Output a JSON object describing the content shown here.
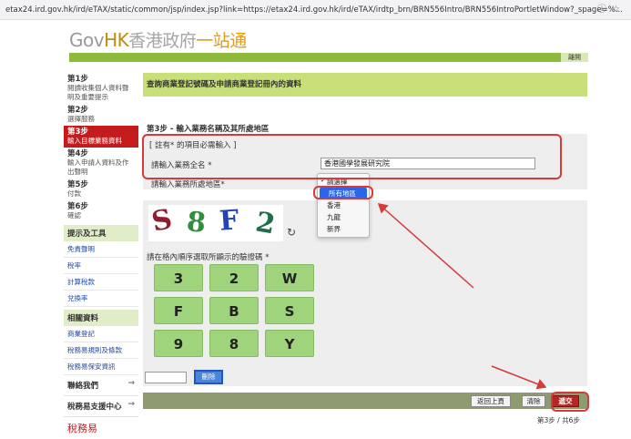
{
  "browser": {
    "url": "etax24.ird.gov.hk/ird/eTAX/static/common/jsp/index.jsp?link=https://etax24.ird.gov.hk/ird/eTAX/irdtp_brn/BRN556Intro/BRN556IntroPortletWindow?_spage=%..."
  },
  "header": {
    "logo_gov": "Gov",
    "logo_hk": "HK",
    "logo_zh": "香港政府",
    "logo_zh2": "一站通",
    "logout_label": "離開"
  },
  "sidebar": {
    "steps": [
      {
        "step": "第1步",
        "label": "閱讀收集個人資料聲明及重要提示"
      },
      {
        "step": "第2步",
        "label": "選擇服務"
      },
      {
        "step": "第3步",
        "label": "輸入目標業務資料",
        "active": true
      },
      {
        "step": "第4步",
        "label": "輸入申請人資料及作出聲明"
      },
      {
        "step": "第5步",
        "label": "付款"
      },
      {
        "step": "第6步",
        "label": "確認"
      }
    ],
    "tools_heading": "提示及工具",
    "tools": [
      "免責聲明",
      "稅率",
      "計算稅款",
      "兌換率"
    ],
    "related_heading": "相關資料",
    "related": [
      "商業登記",
      "稅務易規則及條款",
      "稅務易保安資訊"
    ],
    "contact_label": "聯絡我們",
    "support_label": "稅務易支援中心",
    "bottom_logo_text": "稅務易"
  },
  "main": {
    "title": "查詢商業登記號碼及申請商業登記冊內的資料",
    "step_title": "第3步 - 輸入業務名稱及其所處地區",
    "note": "[ 註有* 的項目必需輸入 ]",
    "name_label": "請輸入業務全名 *",
    "name_value": "香港國學發展研究院",
    "region_label": "請輸入業務所處地區*",
    "region_options": [
      {
        "label": "請選擇",
        "checked": true
      },
      {
        "label": "所有地區",
        "highlighted": true
      },
      {
        "label": "香港"
      },
      {
        "label": "九龍"
      },
      {
        "label": "新界"
      }
    ],
    "captcha_chars": [
      "S",
      "8",
      "F",
      "2"
    ],
    "captcha_label": "請在格內順序選取所顯示的驗證碼 *",
    "keypad": [
      "3",
      "2",
      "W",
      "F",
      "B",
      "S",
      "9",
      "8",
      "Y"
    ],
    "delete_label": "刪除",
    "back_label": "返回上頁",
    "clear_label": "清除",
    "submit_label": "遞交",
    "page_indicator": "第3步 / 共6步"
  },
  "colors": {
    "green_bar": "#8dba3a",
    "title_bar": "#c9e07a",
    "active_step": "#c41c1c",
    "keypad": "#9fd37c",
    "annotation": "#d83a3a"
  }
}
